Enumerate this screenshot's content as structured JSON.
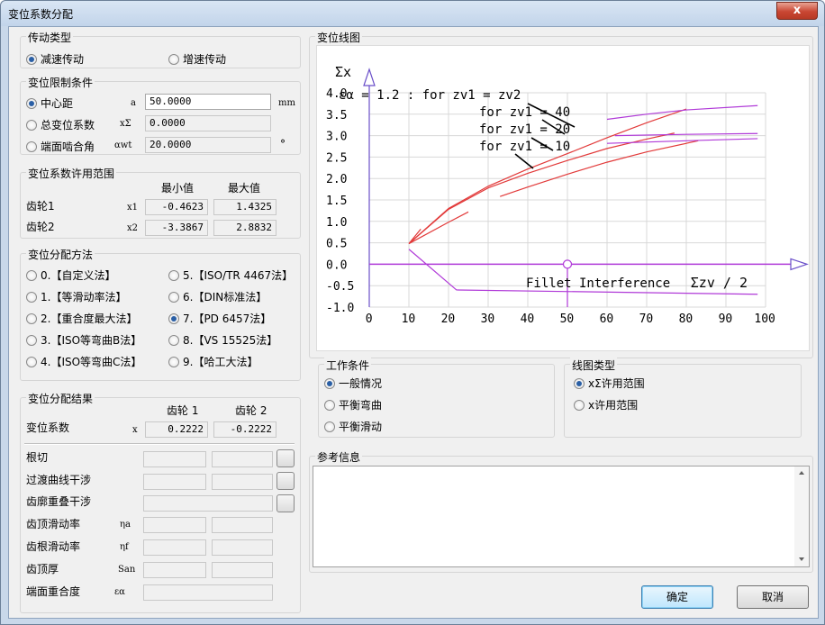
{
  "window": {
    "title": "变位系数分配",
    "close_glyph": "x"
  },
  "drive_type": {
    "title": "传动类型",
    "options": [
      {
        "label": "减速传动",
        "selected": true
      },
      {
        "label": "增速传动",
        "selected": false
      }
    ]
  },
  "limit": {
    "title": "变位限制条件",
    "options": [
      {
        "label": "中心距",
        "symbol": "a",
        "value": "50.0000",
        "unit": "mm",
        "selected": true
      },
      {
        "label": "总变位系数",
        "symbol": "xΣ",
        "value": "0.0000",
        "unit": "",
        "selected": false
      },
      {
        "label": "端面啮合角",
        "symbol": "αwt",
        "value": "20.0000",
        "unit": "°",
        "selected": false
      }
    ]
  },
  "range": {
    "title": "变位系数许用范围",
    "col_min": "最小值",
    "col_max": "最大值",
    "rows": [
      {
        "label": "齿轮1",
        "symbol": "x1",
        "min": "-0.4623",
        "max": "1.4325"
      },
      {
        "label": "齿轮2",
        "symbol": "x2",
        "min": "-3.3867",
        "max": "2.8832"
      }
    ]
  },
  "method": {
    "title": "变位分配方法",
    "left": [
      "0.【自定义法】",
      "1.【等滑动率法】",
      "2.【重合度最大法】",
      "3.【ISO等弯曲B法】",
      "4.【ISO等弯曲C法】"
    ],
    "right": [
      "5.【ISO/TR 4467法】",
      "6.【DIN标准法】",
      "7.【PD 6457法】",
      "8.【VS 15525法】",
      "9.【哈工大法】"
    ],
    "selected": "7"
  },
  "result": {
    "title": "变位分配结果",
    "gear1": "齿轮 1",
    "gear2": "齿轮 2",
    "coef_label": "变位系数",
    "coef_symbol": "x",
    "x1": "0.2222",
    "x2": "-0.2222",
    "rows": [
      {
        "label": "根切",
        "symbol": ""
      },
      {
        "label": "过渡曲线干涉",
        "symbol": ""
      },
      {
        "label": "齿廓重叠干涉",
        "symbol": ""
      },
      {
        "label": "齿顶滑动率",
        "symbol": "ηa"
      },
      {
        "label": "齿根滑动率",
        "symbol": "ηf"
      },
      {
        "label": "齿顶厚",
        "symbol": "San"
      },
      {
        "label": "端面重合度",
        "symbol": "εα"
      }
    ]
  },
  "chart": {
    "title": "变位线图",
    "y_label": "Σx",
    "x_label": "Σzv / 2",
    "annot": [
      "εα = 1.2 : for zv1 = zv2",
      "for zv1 = 40",
      "for zv1 = 20",
      "for zv1 = 10"
    ],
    "interference": "Fillet Interference"
  },
  "chart_data": {
    "type": "line",
    "xlabel": "Σzv / 2",
    "ylabel": "Σx",
    "xlim": [
      0,
      100
    ],
    "ylim": [
      -1.0,
      4.0
    ],
    "x_ticks": [
      0,
      10,
      20,
      30,
      40,
      50,
      60,
      70,
      80,
      90,
      100
    ],
    "y_ticks": [
      -1.0,
      -0.5,
      0.0,
      0.5,
      1.0,
      1.5,
      2.0,
      2.5,
      3.0,
      3.5,
      4.0
    ],
    "grid": true,
    "annotations": [
      "εα = 1.2 : for zv1 = zv2",
      "for zv1 = 40",
      "for zv1 = 20",
      "for zv1 = 10",
      "Fillet Interference"
    ],
    "red_curves": [
      {
        "x": [
          10,
          20,
          30,
          40,
          50,
          60,
          70,
          80
        ],
        "y": [
          0.48,
          1.3,
          1.82,
          2.22,
          2.58,
          2.95,
          3.3,
          3.62
        ]
      },
      {
        "x": [
          10,
          20,
          30,
          40,
          50,
          60,
          70,
          77
        ],
        "y": [
          0.48,
          1.28,
          1.78,
          2.12,
          2.42,
          2.7,
          2.92,
          3.06
        ]
      },
      {
        "x": [
          10,
          20,
          25
        ],
        "y": [
          0.48,
          0.98,
          1.22
        ]
      },
      {
        "x": [
          33,
          40,
          50,
          60,
          70,
          83
        ],
        "y": [
          1.58,
          1.8,
          2.1,
          2.38,
          2.62,
          2.88
        ]
      },
      {
        "x": [
          10,
          13
        ],
        "y": [
          0.48,
          0.82
        ]
      }
    ],
    "magenta_upper": [
      {
        "x": [
          60,
          70,
          80,
          98
        ],
        "y": [
          3.38,
          3.5,
          3.6,
          3.7
        ]
      },
      {
        "x": [
          62,
          80,
          98
        ],
        "y": [
          3.0,
          3.03,
          3.05
        ]
      },
      {
        "x": [
          60,
          80,
          98
        ],
        "y": [
          2.82,
          2.88,
          2.93
        ]
      }
    ],
    "magenta_lower": {
      "x": [
        10,
        22,
        98
      ],
      "y": [
        0.35,
        -0.6,
        -0.7
      ]
    },
    "marker": {
      "x": 50,
      "y": 0.0
    },
    "zero_line": 0.0,
    "vertical_line": 50
  },
  "work_cond": {
    "title": "工作条件",
    "options": [
      {
        "label": "一般情况",
        "selected": true
      },
      {
        "label": "平衡弯曲",
        "selected": false
      },
      {
        "label": "平衡滑动",
        "selected": false
      }
    ]
  },
  "line_type": {
    "title": "线图类型",
    "options": [
      {
        "label": "xΣ许用范围",
        "selected": true
      },
      {
        "label": "x许用范围",
        "selected": false
      }
    ]
  },
  "ref": {
    "title": "参考信息"
  },
  "buttons": {
    "ok": "确定",
    "cancel": "取消"
  },
  "colors": {
    "curve": "#e23a3a",
    "limit": "#b03ad8",
    "axis": "#6a4fc9"
  }
}
